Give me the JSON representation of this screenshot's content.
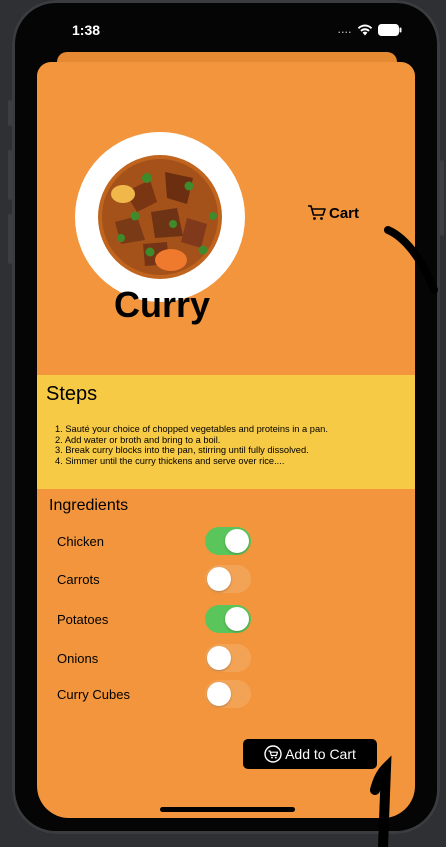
{
  "status_bar": {
    "time": "1:38",
    "signal_icon": "signal-dots-icon",
    "wifi_icon": "wifi-icon",
    "battery_icon": "battery-icon"
  },
  "header": {
    "image_icon": "curry-bowl-image",
    "cart_label": "Cart",
    "cart_icon": "cart-icon",
    "title": "Curry"
  },
  "steps": {
    "title": "Steps",
    "items": [
      "1. Sauté your choice of chopped vegetables and proteins in a pan.",
      "2. Add water or broth and bring to a boil.",
      "3. Break curry blocks into the pan, stirring until fully dissolved.",
      "4. Simmer until the curry thickens and serve over rice...."
    ]
  },
  "ingredients": {
    "title": "Ingredients",
    "items": [
      {
        "label": "Chicken",
        "selected": true
      },
      {
        "label": "Carrots",
        "selected": false
      },
      {
        "label": "Potatoes",
        "selected": true
      },
      {
        "label": "Onions",
        "selected": false
      },
      {
        "label": "Curry Cubes",
        "selected": false
      }
    ]
  },
  "add_to_cart": {
    "label": "Add to Cart",
    "icon": "cart-circle-icon"
  },
  "colors": {
    "background": "#f2953c",
    "steps_panel": "#f7ca45",
    "toggle_on": "#5ac55a",
    "button": "#000000"
  }
}
